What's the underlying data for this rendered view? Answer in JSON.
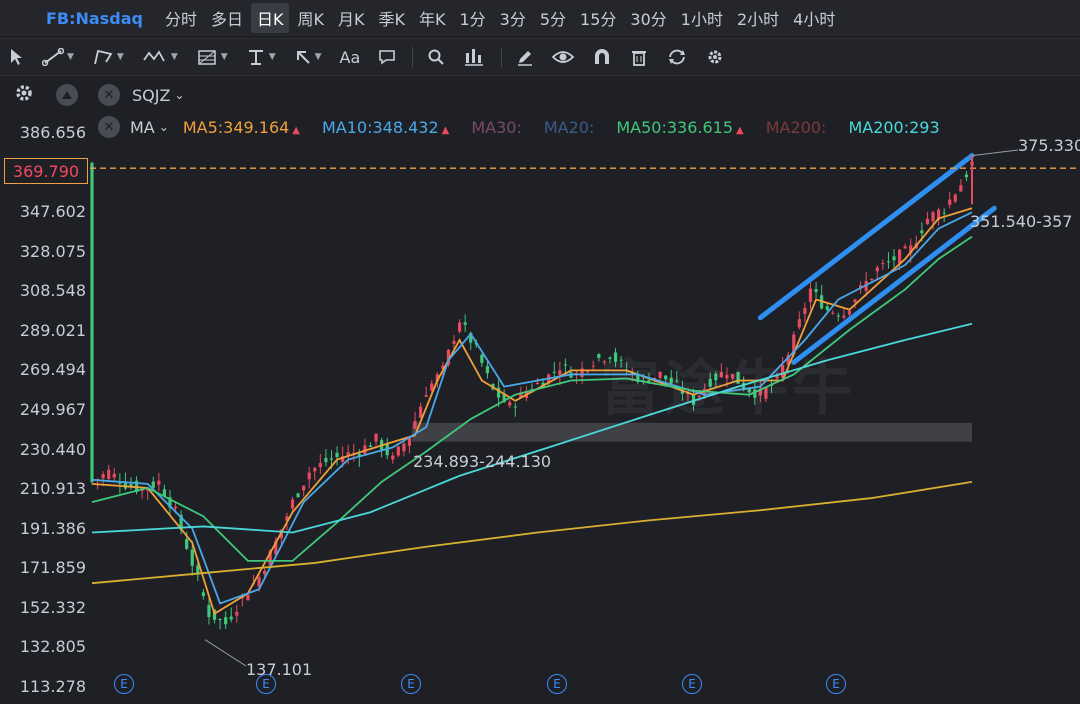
{
  "header": {
    "symbol": "FB:Nasdaq",
    "timeframes": [
      "分时",
      "多日",
      "日K",
      "周K",
      "月K",
      "季K",
      "年K",
      "1分",
      "3分",
      "5分",
      "15分",
      "30分",
      "1小时",
      "2小时",
      "4小时"
    ],
    "active_timeframe": "日K"
  },
  "toolbar": {
    "tools": [
      "cursor-icon",
      "trend-line-icon",
      "polyline-icon",
      "wave-icon",
      "fibonacci-icon",
      "horizontal-line-icon",
      "arrow-icon",
      "text-icon",
      "comment-icon",
      "search-icon",
      "measure-icon",
      "pen-icon",
      "eye-icon",
      "magnet-icon",
      "trash-icon",
      "sync-icon",
      "gear-icon"
    ],
    "text_tool_label": "Aa"
  },
  "indicators": {
    "sub_indicator": "SQJZ",
    "main_indicator": "MA",
    "ma_values": [
      {
        "label": "MA5:349.164",
        "color": "#f0a03a",
        "arrow": "▲"
      },
      {
        "label": "MA10:348.432",
        "color": "#4aa8e8",
        "arrow": "▲"
      },
      {
        "label": "MA30:",
        "color": "#7a4a6a",
        "arrow": ""
      },
      {
        "label": "MA20:",
        "color": "#3a5a8a",
        "arrow": ""
      },
      {
        "label": "MA50:336.615",
        "color": "#3fc87a",
        "arrow": "▲"
      },
      {
        "label": "MA200:",
        "color": "#7a3a3a",
        "arrow": ""
      },
      {
        "label": "MA200:293",
        "color": "#4ad8d8",
        "arrow": ""
      }
    ]
  },
  "price_axis": {
    "ticks": [
      "386.656",
      "347.602",
      "328.075",
      "308.548",
      "289.021",
      "269.494",
      "249.967",
      "230.440",
      "210.913",
      "191.386",
      "171.859",
      "152.332",
      "132.805",
      "113.278"
    ],
    "current_price": "369.790"
  },
  "annotations": {
    "high_label": "375.330",
    "range_label": "351.540-357",
    "support_label": "234.893-244.130",
    "low_label": "137.101"
  },
  "earnings_marker": "E",
  "watermark": "富途牛牛",
  "colors": {
    "up": "#e84a5f",
    "down": "#3fc87a",
    "channel": "#2f8ff0",
    "ma5": "#f0a03a",
    "ma10": "#4aa8e8",
    "ma50": "#3fc87a",
    "ma200": "#4ad8d8",
    "ma_long": "#d8b030",
    "price_line": "#f0a040"
  },
  "chart_data": {
    "type": "candlestick",
    "ylim": [
      113.278,
      386.656
    ],
    "price_points": [
      [
        0,
        215
      ],
      [
        3,
        220
      ],
      [
        6,
        214
      ],
      [
        9,
        211
      ],
      [
        12,
        215
      ],
      [
        15,
        200
      ],
      [
        18,
        175
      ],
      [
        21,
        150
      ],
      [
        24,
        145
      ],
      [
        27,
        158
      ],
      [
        30,
        168
      ],
      [
        33,
        185
      ],
      [
        36,
        205
      ],
      [
        39,
        220
      ],
      [
        42,
        225
      ],
      [
        45,
        228
      ],
      [
        48,
        230
      ],
      [
        51,
        236
      ],
      [
        54,
        226
      ],
      [
        57,
        238
      ],
      [
        60,
        260
      ],
      [
        63,
        270
      ],
      [
        66,
        295
      ],
      [
        69,
        280
      ],
      [
        72,
        260
      ],
      [
        75,
        252
      ],
      [
        78,
        260
      ],
      [
        81,
        265
      ],
      [
        84,
        272
      ],
      [
        87,
        268
      ],
      [
        90,
        275
      ],
      [
        93,
        278
      ],
      [
        96,
        270
      ],
      [
        99,
        265
      ],
      [
        102,
        268
      ],
      [
        105,
        262
      ],
      [
        108,
        255
      ],
      [
        111,
        265
      ],
      [
        114,
        270
      ],
      [
        117,
        262
      ],
      [
        120,
        258
      ],
      [
        123,
        265
      ],
      [
        126,
        285
      ],
      [
        129,
        310
      ],
      [
        132,
        300
      ],
      [
        135,
        298
      ],
      [
        138,
        310
      ],
      [
        141,
        320
      ],
      [
        144,
        325
      ],
      [
        147,
        330
      ],
      [
        150,
        345
      ],
      [
        153,
        350
      ],
      [
        156,
        362
      ],
      [
        158,
        372
      ]
    ],
    "ma_series": [
      {
        "name": "MA5",
        "values": [
          [
            0,
            214
          ],
          [
            10,
            212
          ],
          [
            18,
            185
          ],
          [
            22,
            150
          ],
          [
            28,
            160
          ],
          [
            36,
            200
          ],
          [
            44,
            226
          ],
          [
            52,
            233
          ],
          [
            58,
            238
          ],
          [
            62,
            265
          ],
          [
            66,
            285
          ],
          [
            70,
            265
          ],
          [
            76,
            255
          ],
          [
            86,
            270
          ],
          [
            96,
            270
          ],
          [
            108,
            258
          ],
          [
            116,
            265
          ],
          [
            124,
            265
          ],
          [
            130,
            305
          ],
          [
            136,
            300
          ],
          [
            146,
            325
          ],
          [
            152,
            345
          ],
          [
            158,
            350
          ]
        ]
      },
      {
        "name": "MA10",
        "values": [
          [
            0,
            216
          ],
          [
            10,
            214
          ],
          [
            18,
            192
          ],
          [
            23,
            155
          ],
          [
            30,
            162
          ],
          [
            38,
            205
          ],
          [
            46,
            226
          ],
          [
            54,
            232
          ],
          [
            60,
            242
          ],
          [
            64,
            275
          ],
          [
            68,
            288
          ],
          [
            74,
            262
          ],
          [
            86,
            268
          ],
          [
            98,
            268
          ],
          [
            110,
            258
          ],
          [
            120,
            262
          ],
          [
            128,
            285
          ],
          [
            134,
            305
          ],
          [
            146,
            322
          ],
          [
            152,
            340
          ],
          [
            158,
            348
          ]
        ]
      },
      {
        "name": "MA50",
        "values": [
          [
            0,
            205
          ],
          [
            10,
            212
          ],
          [
            20,
            198
          ],
          [
            28,
            176
          ],
          [
            36,
            176
          ],
          [
            44,
            195
          ],
          [
            52,
            215
          ],
          [
            60,
            230
          ],
          [
            68,
            246
          ],
          [
            76,
            258
          ],
          [
            86,
            265
          ],
          [
            96,
            266
          ],
          [
            108,
            260
          ],
          [
            118,
            258
          ],
          [
            126,
            268
          ],
          [
            136,
            290
          ],
          [
            146,
            310
          ],
          [
            152,
            325
          ],
          [
            158,
            336
          ]
        ]
      },
      {
        "name": "MA200",
        "values": [
          [
            0,
            190
          ],
          [
            20,
            193
          ],
          [
            36,
            190
          ],
          [
            50,
            200
          ],
          [
            66,
            218
          ],
          [
            82,
            232
          ],
          [
            100,
            248
          ],
          [
            116,
            262
          ],
          [
            132,
            275
          ],
          [
            146,
            285
          ],
          [
            158,
            293
          ]
        ]
      },
      {
        "name": "MA_long",
        "values": [
          [
            0,
            165
          ],
          [
            20,
            170
          ],
          [
            40,
            175
          ],
          [
            60,
            183
          ],
          [
            80,
            190
          ],
          [
            100,
            196
          ],
          [
            120,
            201
          ],
          [
            140,
            207
          ],
          [
            158,
            215
          ]
        ]
      }
    ],
    "channel_lines": [
      {
        "from": [
          120,
          296
        ],
        "to": [
          158,
          376
        ]
      },
      {
        "from": [
          126,
          274
        ],
        "to": [
          162,
          350
        ]
      }
    ],
    "support_zone": [
      234.893,
      244.13
    ],
    "current_price": 369.79
  }
}
